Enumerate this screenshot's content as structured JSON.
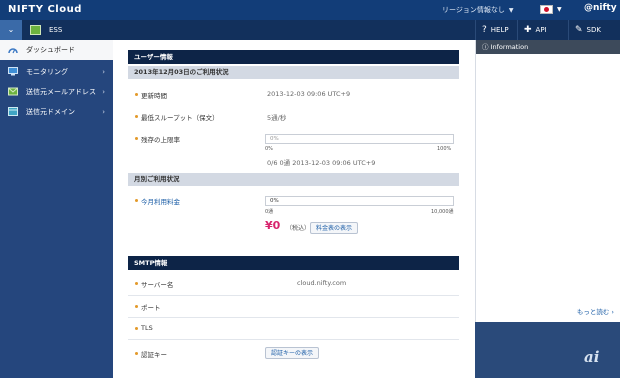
{
  "topbar": {
    "brand": "NIFTY Cloud",
    "region": "リージョン情報なし",
    "region_caret": "▼",
    "flag_caret": "▼",
    "logo": "@nifty"
  },
  "subbar": {
    "toggle": "⌄",
    "service": "ESS",
    "help": "HELP",
    "api": "API",
    "sdk": "SDK"
  },
  "sidebar": {
    "items": [
      {
        "label": "ダッシュボード"
      },
      {
        "label": "モニタリング"
      },
      {
        "label": "送信元メールアドレス"
      },
      {
        "label": "送信元ドメイン"
      }
    ],
    "chevron": "›"
  },
  "user_info": {
    "title": "ユーザー情報",
    "usage_title": "2013年12月03日のご利用状況",
    "updated_label": "更新時間",
    "updated_value": "2013-12-03 09:06 UTC+9",
    "throughput_label": "最低スループット（保文）",
    "throughput_value": "5通/秒",
    "remaining_label": "残存の上限率",
    "remaining_value": "0%",
    "remaining_fraction": 0.0,
    "remaining_min": "0%",
    "remaining_max": "100%",
    "sent_note": "0/6 0通    2013-12-03 09:06 UTC+9",
    "monthly_title": "月別ご利用状況",
    "monthly_label": "今月利用料金",
    "monthly_value": "0%",
    "monthly_fraction": 0.0,
    "monthly_min": "0通",
    "monthly_max": "10,000通",
    "fee": "¥0",
    "fee_note": "（税込）",
    "fee_button": "料金表の表示"
  },
  "smtp": {
    "title": "SMTP情報",
    "server_label": "サーバー名",
    "server_value": "cloud.nifty.com",
    "port_label": "ポート",
    "tls_label": "TLS",
    "auth_label": "認証キー",
    "auth_button": "認証キーの表示"
  },
  "info_panel": {
    "title": "Information",
    "more": "もっと読む"
  },
  "corner_logo": "ai",
  "colors": {
    "topbar": "#123d78",
    "sidebar": "#25467d",
    "section_header": "#0d2447",
    "fee_accent": "#d8256e",
    "ess_icon": "#6db33f"
  }
}
